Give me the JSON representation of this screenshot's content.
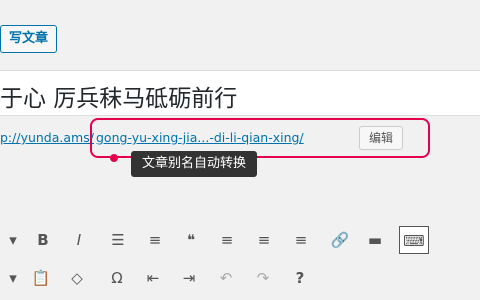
{
  "header": {
    "write_label": "写文章"
  },
  "title": {
    "text": "于心 厉兵秣马砥砺前行"
  },
  "permalink": {
    "prefix": "p://yunda.ams/",
    "slug": "gong-yu-xing-jia...-di-li-qian-xing/",
    "edit_label": "编辑"
  },
  "tooltip": {
    "text": "文章别名自动转换"
  },
  "colors": {
    "accent": "#0073aa",
    "highlight": "#e5004f"
  },
  "toolbar": {
    "row1": [
      {
        "name": "format-dropdown-icon",
        "glyph": "▾"
      },
      {
        "name": "bold-icon",
        "glyph": "B"
      },
      {
        "name": "italic-icon",
        "glyph": "I"
      },
      {
        "name": "bullet-list-icon",
        "glyph": "☰"
      },
      {
        "name": "numbered-list-icon",
        "glyph": "≡"
      },
      {
        "name": "blockquote-icon",
        "glyph": "❝"
      },
      {
        "name": "align-left-icon",
        "glyph": "≡"
      },
      {
        "name": "align-center-icon",
        "glyph": "≡"
      },
      {
        "name": "align-right-icon",
        "glyph": "≡"
      },
      {
        "name": "link-icon",
        "glyph": "🔗"
      },
      {
        "name": "read-more-icon",
        "glyph": "▬"
      },
      {
        "name": "toolbar-toggle-icon",
        "glyph": "⌨"
      }
    ],
    "row2": [
      {
        "name": "text-color-dropdown-icon",
        "glyph": "▾"
      },
      {
        "name": "paste-text-icon",
        "glyph": "📋"
      },
      {
        "name": "clear-formatting-icon",
        "glyph": "◇"
      },
      {
        "name": "special-character-icon",
        "glyph": "Ω"
      },
      {
        "name": "outdent-icon",
        "glyph": "⇤"
      },
      {
        "name": "indent-icon",
        "glyph": "⇥"
      },
      {
        "name": "undo-icon",
        "glyph": "↶"
      },
      {
        "name": "redo-icon",
        "glyph": "↷"
      },
      {
        "name": "help-icon",
        "glyph": "?"
      }
    ]
  }
}
